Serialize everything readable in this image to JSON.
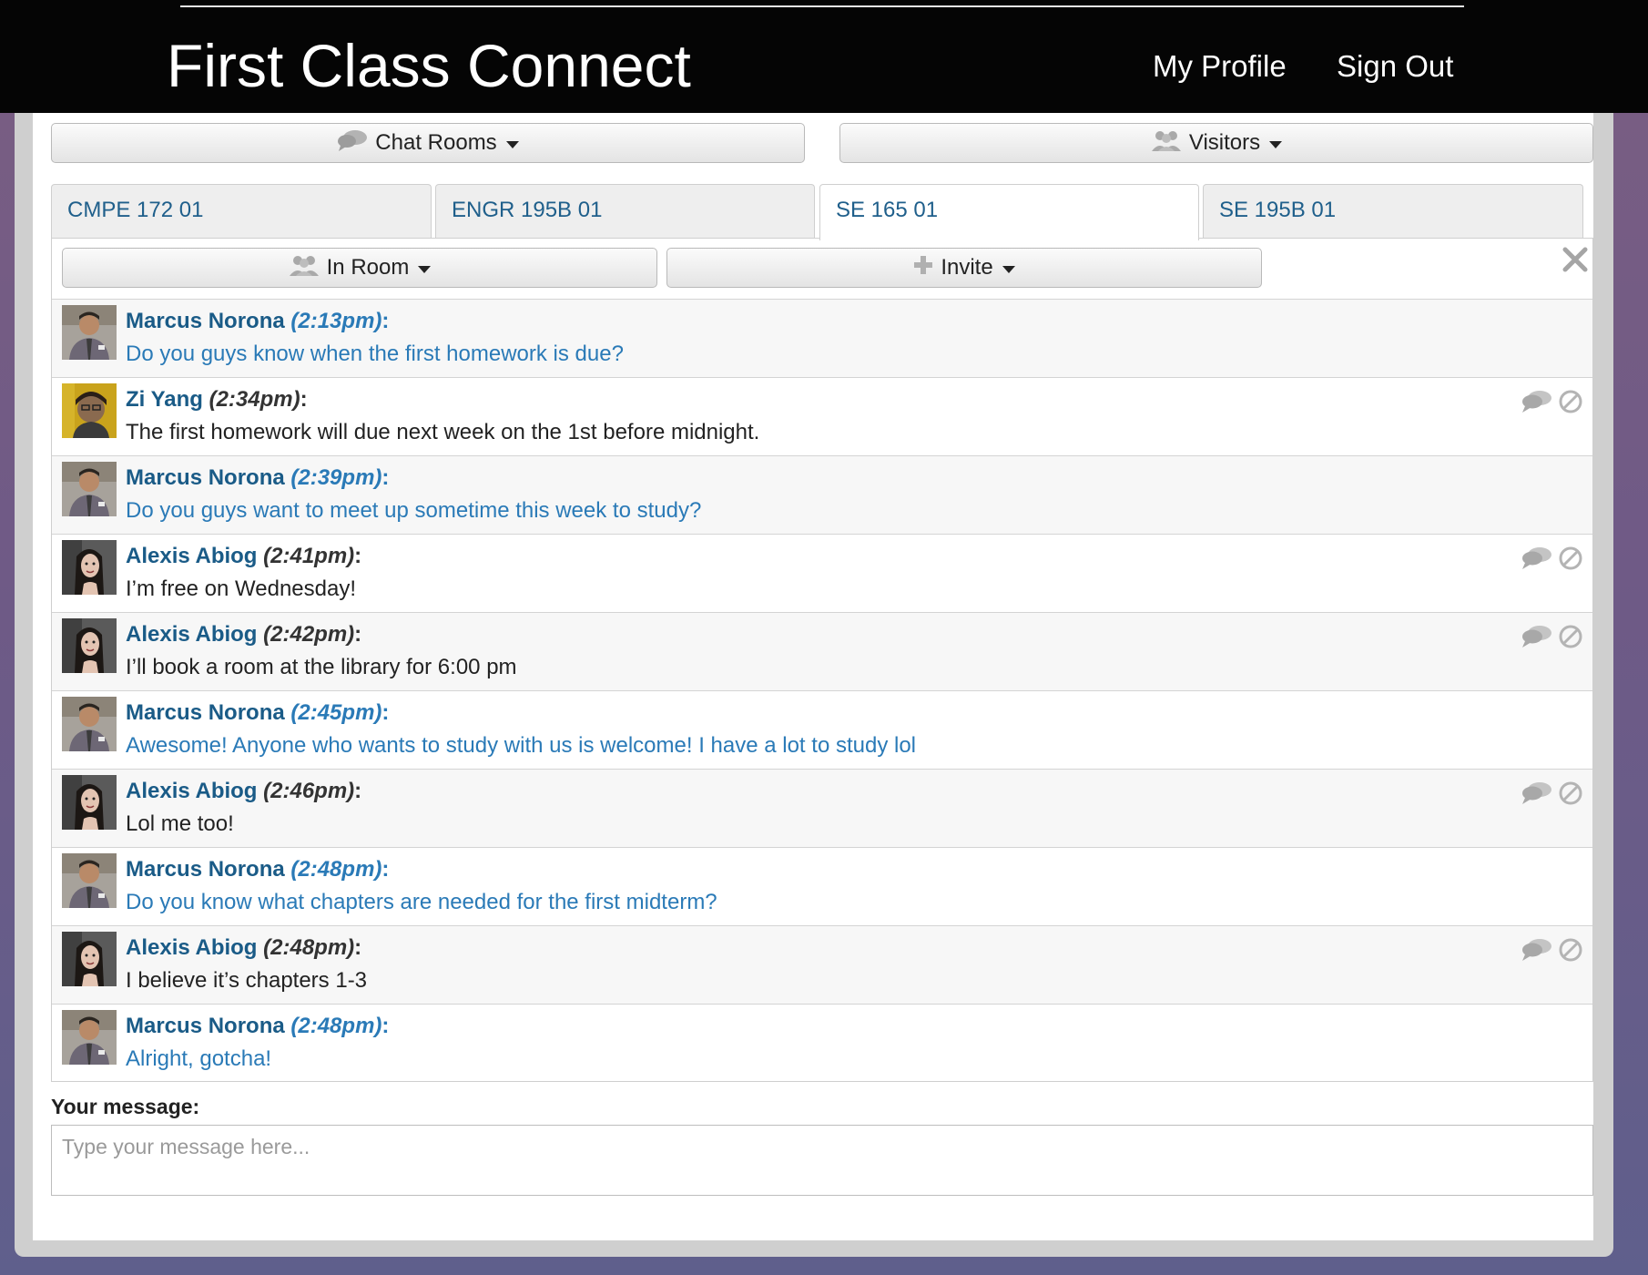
{
  "header": {
    "brand": "First Class Connect",
    "nav": {
      "profile": "My Profile",
      "signout": "Sign Out"
    }
  },
  "toolbar": {
    "chat_rooms": "Chat Rooms",
    "visitors": "Visitors"
  },
  "tabs": [
    {
      "label": "CMPE 172 01",
      "active": false
    },
    {
      "label": "ENGR 195B 01",
      "active": false
    },
    {
      "label": "SE 165 01",
      "active": true
    },
    {
      "label": "SE 195B 01",
      "active": false
    }
  ],
  "room": {
    "in_room": "In Room",
    "invite": "Invite"
  },
  "messages": [
    {
      "name": "Marcus Norona",
      "time": "(2:13pm)",
      "text": "Do you guys know when the first homework is due?",
      "self": true
    },
    {
      "name": "Zi Yang",
      "time": "(2:34pm)",
      "text": "The first homework will due next week on the 1st before midnight.",
      "self": false
    },
    {
      "name": "Marcus Norona",
      "time": "(2:39pm)",
      "text": "Do you guys want to meet up sometime this week to study?",
      "self": true
    },
    {
      "name": "Alexis Abiog",
      "time": "(2:41pm)",
      "text": "I’m free on Wednesday!",
      "self": false
    },
    {
      "name": "Alexis Abiog",
      "time": "(2:42pm)",
      "text": "I’ll book a room at the library for 6:00 pm",
      "self": false
    },
    {
      "name": "Marcus Norona",
      "time": "(2:45pm)",
      "text": "Awesome! Anyone who wants to study with us is welcome! I have a lot to study lol",
      "self": true
    },
    {
      "name": "Alexis Abiog",
      "time": "(2:46pm)",
      "text": "Lol me too!",
      "self": false
    },
    {
      "name": "Marcus Norona",
      "time": "(2:48pm)",
      "text": "Do you know what chapters are needed for the first midterm?",
      "self": true
    },
    {
      "name": "Alexis Abiog",
      "time": "(2:48pm)",
      "text": "I believe it’s chapters 1-3",
      "self": false
    },
    {
      "name": "Marcus Norona",
      "time": "(2:48pm)",
      "text": "Alright, gotcha!",
      "self": true
    }
  ],
  "composer": {
    "label": "Your message:",
    "placeholder": "Type your message here...",
    "value": ""
  },
  "colors": {
    "header_bg": "#050505",
    "name_blue": "#1a5b87",
    "self_text_blue": "#2a7ab7"
  },
  "icons": [
    "chat-bubbles-icon",
    "users-icon",
    "plus-icon",
    "close-icon",
    "reply-icon",
    "block-icon",
    "caret-down-icon"
  ]
}
